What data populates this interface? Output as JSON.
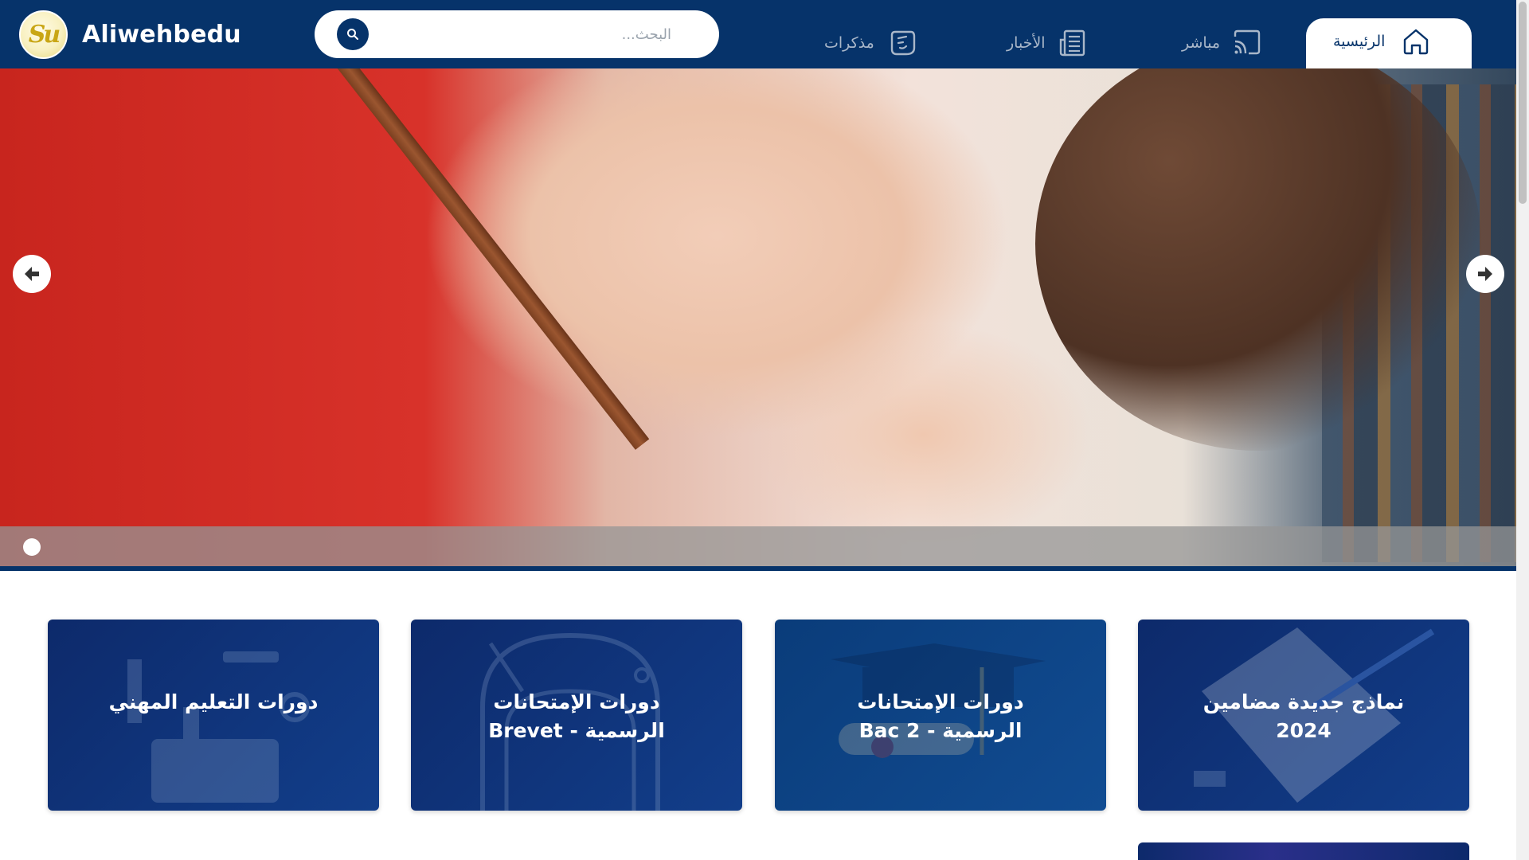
{
  "header": {
    "brand": "Aliwehbedu",
    "logo_text": "Su",
    "search_placeholder": "البحث...",
    "nav": [
      {
        "label": "الرئيسية",
        "icon": "home-icon"
      },
      {
        "label": "مباشر",
        "icon": "cast-icon"
      },
      {
        "label": "الأخبار",
        "icon": "newspaper-icon"
      },
      {
        "label": "مذكرات",
        "icon": "notes-icon"
      }
    ]
  },
  "hero": {
    "slide_count": 1,
    "active_slide": 1
  },
  "cards": [
    {
      "title": "نماذج جديدة مضامين 2024",
      "icon": "notebook-pencil-icon"
    },
    {
      "title": "دورات الإمتحانات الرسمية - Bac 2",
      "icon": "graduation-cap-icon"
    },
    {
      "title": "دورات الإمتحانات الرسمية - Brevet",
      "icon": "backpack-icon"
    },
    {
      "title": "دورات التعليم المهني",
      "icon": "tools-icon"
    }
  ],
  "colors": {
    "primary": "#06336a",
    "card": "#0d2a6b",
    "background": "#ffffff"
  }
}
